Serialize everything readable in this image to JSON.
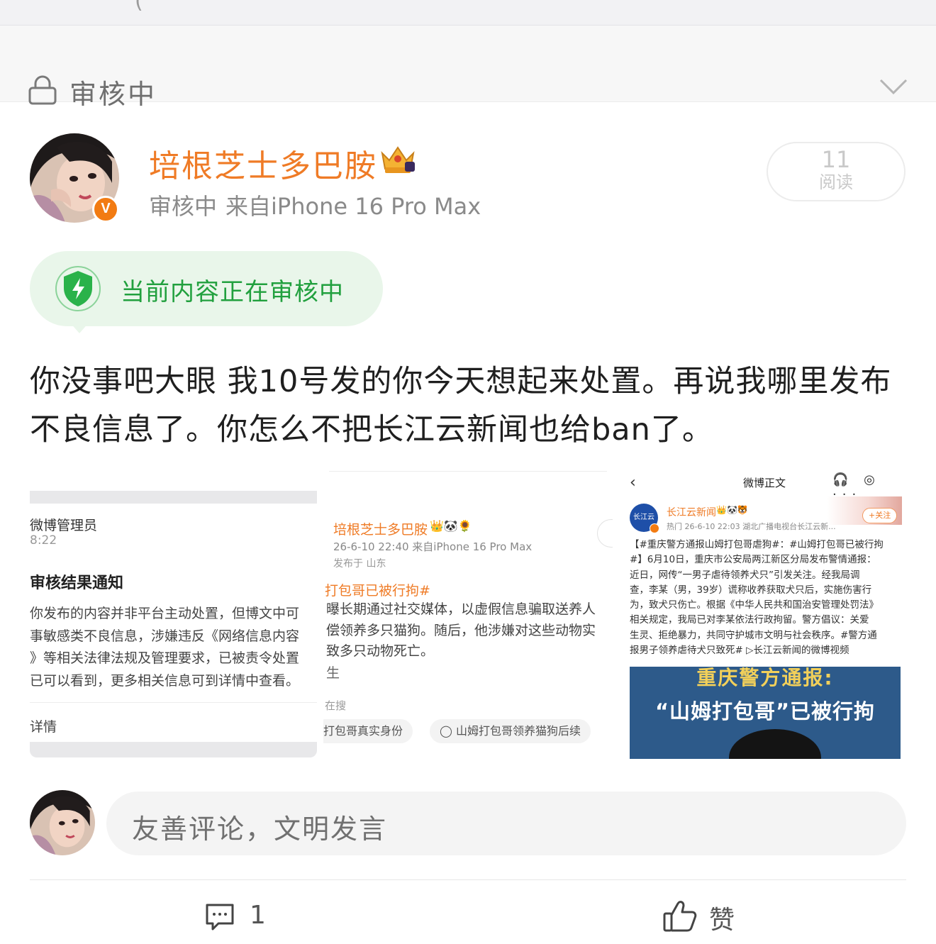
{
  "review_bar": {
    "status": "审核中"
  },
  "post": {
    "username": "培根芝士多巴胺",
    "meta_status": "审核中",
    "meta_source": "来自iPhone 16 Pro Max",
    "read_count": "11",
    "read_label": "阅读",
    "notice": "当前内容正在审核中",
    "text": "你没事吧大眼 我10号发的你今天想起来处置。再说我哪里发布不良信息了。你怎么不把长江云新闻也给ban了。"
  },
  "images": {
    "admin_notice": {
      "sender": "微博管理员",
      "time": "8:22",
      "heading": "审核结果通知",
      "body": "你发布的内容并非平台主动处置，但博文中可\n事敏感类不良信息，涉嫌违反《网络信息内容\n》等相关法律法规及管理要求，已被责令处置\n已可以看到，更多相关信息可到详情中查看。",
      "detail_link": "详情"
    },
    "original_post": {
      "username": "培根芝士多巴胺",
      "emoji": "👑🐼🌻",
      "meta": "26-6-10 22:40 来自iPhone 16 Pro Max",
      "location": "发布于 山东",
      "hashtag": "打包哥已被行拘#",
      "body": "曝长期通过社交媒体，以虚假信息骗取送养人\n偿领养多只猫狗。随后，他涉嫌对这些动物实\n致多只动物死亡。",
      "tail": "生",
      "search_label": "在搜",
      "chip_1": "打包哥真实身份",
      "chip_2": "山姆打包哥领养猫狗后续"
    },
    "news_post": {
      "back": "‹",
      "title": "微博正文",
      "top_icons": "🎧 ◎ ···",
      "logo_text": "长江云",
      "username": "长江云新闻",
      "emoji": "👑🐼🐯",
      "meta": "热门 26-6-10 22:03 湖北广播电视台长江云新...",
      "follow": "+关注",
      "body": "【#重庆警方通报山姆打包哥虐狗#：#山姆打包哥已被行拘\n#】6月10日，重庆市公安局两江新区分局发布警情通报：\n近日，网传“一男子虐待领养犬只”引发关注。经我局调\n查，李某（男，39岁）谎称收养获取犬只后，实施伤害行\n为，致犬只伤亡。根据《中华人民共和国治安管理处罚法》\n相关规定，我局已对李某依法行政拘留。警方倡议：关爱\n生灵、拒绝暴力，共同守护城市文明与社会秩序。#警方通\n报男子领养虐待犬只致死# ▷长江云新闻的微博视频",
      "video_title_1": "重庆警方通报:",
      "video_title_2": "“山姆打包哥”已被行拘"
    }
  },
  "comment": {
    "placeholder": "友善评论，文明发言"
  },
  "actions": {
    "comment_count": "1",
    "like_label": "赞"
  },
  "colors": {
    "username": "#ef7b26",
    "notice_green": "#21a03e",
    "notice_bg": "#e9f6ea",
    "badge_orange": "#f27b12"
  },
  "icons": [
    "lock-icon",
    "chevron-down-icon",
    "crown-icon",
    "verified-icon",
    "shield-icon",
    "comment-icon",
    "like-icon"
  ]
}
